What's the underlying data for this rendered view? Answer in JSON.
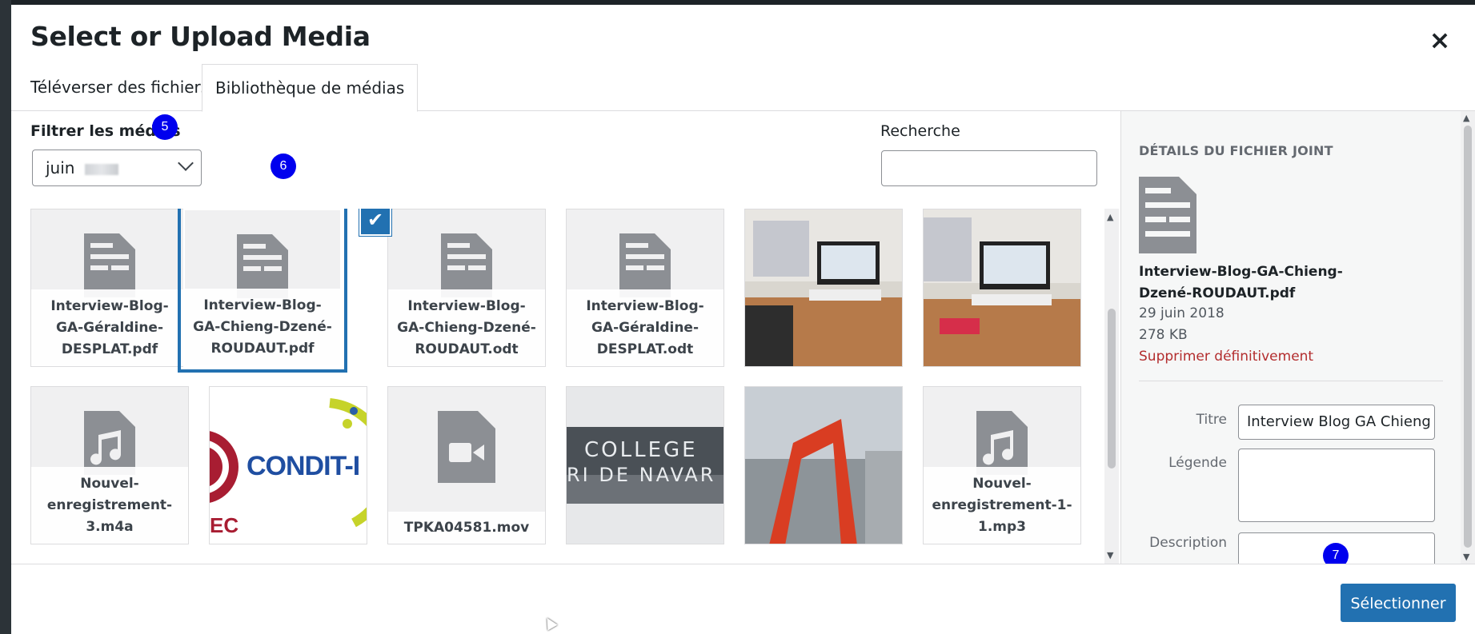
{
  "modal": {
    "title": "Select or Upload Media",
    "close_label": "×"
  },
  "tabs": [
    {
      "label": "Téléverser des fichiers"
    },
    {
      "label": "Bibliothèque de médias"
    }
  ],
  "filter": {
    "label": "Filtrer les médias",
    "selected": "juin"
  },
  "search": {
    "label": "Recherche",
    "value": ""
  },
  "badges": [
    "5",
    "6",
    "7"
  ],
  "check_mark": "✔",
  "items": [
    {
      "type": "document",
      "name": "Interview-Blog-GA-Géraldine-DESPLAT.pdf",
      "selected": false
    },
    {
      "type": "document",
      "name": "Interview-Blog-GA-Chieng-Dzené-ROUDAUT.pdf",
      "selected": true
    },
    {
      "type": "document",
      "name": "Interview-Blog-GA-Chieng-Dzené-ROUDAUT.odt",
      "selected": false
    },
    {
      "type": "document",
      "name": "Interview-Blog-GA-Géraldine-DESPLAT.odt",
      "selected": false
    },
    {
      "type": "image",
      "name": "",
      "selected": false
    },
    {
      "type": "image",
      "name": "",
      "selected": false
    },
    {
      "type": "audio",
      "name": "Nouvel-enregistrement-3.m4a",
      "selected": false
    },
    {
      "type": "image",
      "name": "",
      "selected": false,
      "visible_text": "CONDIT-I",
      "visible_text2": "EC"
    },
    {
      "type": "video",
      "name": "TPKA04581.mov",
      "selected": false
    },
    {
      "type": "image",
      "name": "",
      "selected": false,
      "visible_text": "COLLEGE",
      "visible_text2": "RI DE NAVAR"
    },
    {
      "type": "image",
      "name": "",
      "selected": false
    },
    {
      "type": "audio",
      "name": "Nouvel-enregistrement-1-1.mp3",
      "selected": false
    }
  ],
  "details": {
    "heading": "Détails du fichier joint",
    "filename": "Interview-Blog-GA-Chieng-Dzené-ROUDAUT.pdf",
    "date": "29 juin 2018",
    "size": "278 KB",
    "delete_label": "Supprimer définitivement",
    "fields": {
      "title_label": "Titre",
      "title_value": "Interview Blog GA Chieng",
      "caption_label": "Légende",
      "caption_value": "",
      "description_label": "Description"
    }
  },
  "toolbar": {
    "select_label": "Sélectionner"
  },
  "colors": {
    "accent": "#2271b1",
    "delete": "#b32d2e",
    "badge": "#0000ee"
  }
}
